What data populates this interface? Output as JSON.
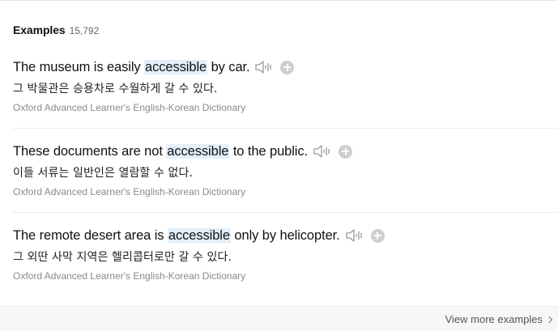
{
  "examples_section": {
    "title": "Examples",
    "count": "15,792",
    "items": [
      {
        "before": "The museum is easily ",
        "highlight": "accessible",
        "after": " by car.",
        "translation": "그 박물관은 승용차로 수월하게 갈 수 있다.",
        "source": "Oxford Advanced Learner's English-Korean Dictionary"
      },
      {
        "before": "These documents are not ",
        "highlight": "accessible",
        "after": " to the public.",
        "translation": "이들 서류는 일반인은 열람할 수 없다.",
        "source": "Oxford Advanced Learner's English-Korean Dictionary"
      },
      {
        "before": "The remote desert area is ",
        "highlight": "accessible",
        "after": " only by helicopter.",
        "translation": "그 외딴 사막 지역은 헬리콥터로만 갈 수 있다.",
        "source": "Oxford Advanced Learner's English-Korean Dictionary"
      }
    ],
    "icons": {
      "audio": "speaker-icon",
      "add": "plus-circle-icon"
    }
  },
  "footer": {
    "view_more_label": "View more examples",
    "icon": "chevron-right-icon"
  },
  "colors": {
    "highlight_bg": "#e3effb",
    "source_text": "#8a8a8a",
    "icon_gray": "#cfcfcf"
  }
}
